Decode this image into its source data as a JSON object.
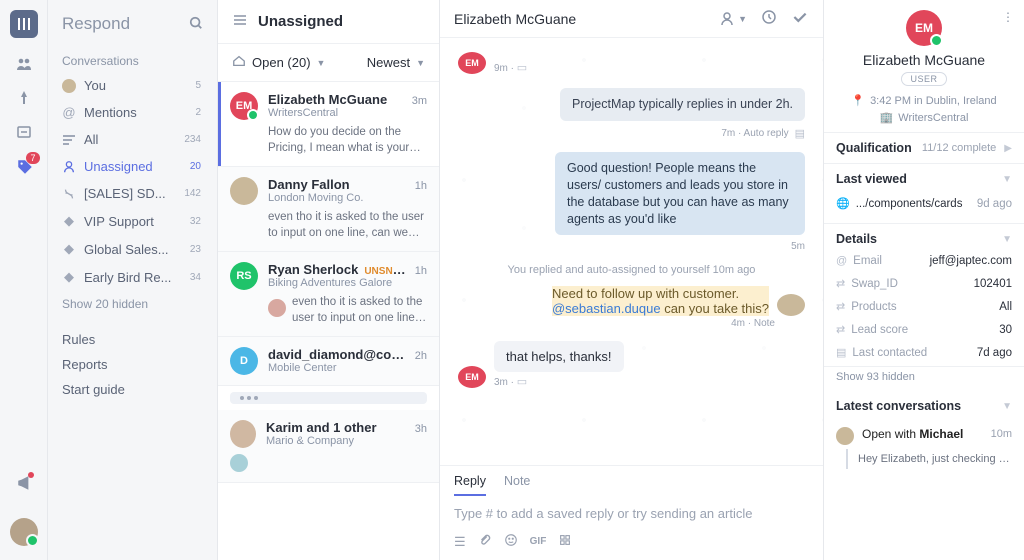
{
  "rail": {
    "tags_badge": "7"
  },
  "nav": {
    "title": "Respond",
    "section": "Conversations",
    "items": [
      {
        "label": "You",
        "count": "5"
      },
      {
        "label": "Mentions",
        "count": "2"
      },
      {
        "label": "All",
        "count": "234"
      },
      {
        "label": "Unassigned",
        "count": "20"
      },
      {
        "label": "[SALES] SD...",
        "count": "142"
      },
      {
        "label": "VIP Support",
        "count": "32"
      },
      {
        "label": "Global Sales...",
        "count": "23"
      },
      {
        "label": "Early Bird Re...",
        "count": "34"
      }
    ],
    "show_hidden": "Show 20 hidden",
    "foot": [
      "Rules",
      "Reports",
      "Start guide"
    ]
  },
  "list": {
    "title": "Unassigned",
    "filter_status": "Open (20)",
    "sort": "Newest",
    "items": [
      {
        "name": "Elizabeth McGuane",
        "org": "WritersCentral",
        "time": "3m",
        "preview": "How do you decide on the Pricing, I mean what is your definition of People? When...",
        "initials": "EM",
        "color": "#e1465a"
      },
      {
        "name": "Danny Fallon",
        "org": "London Moving Co.",
        "time": "1h",
        "preview": "even tho it is asked to the user to input on one line, can we show more lines of text...",
        "color": "#c9b89a"
      },
      {
        "name": "Ryan Sherlock",
        "org": "Biking Adventures Galore",
        "time": "1h",
        "tag": "UNSNOOZED",
        "preview": "even tho it is asked to the user to input on one line, can we show...",
        "initials": "RS",
        "color": "#1fc36a"
      },
      {
        "name": "david_diamond@comp...",
        "org": "Mobile Center",
        "time": "2h",
        "preview": "",
        "initials": "D",
        "color": "#4bb7e6"
      },
      {
        "name": "Karim and 1 other",
        "org": "Mario & Company",
        "time": "3h",
        "preview": "",
        "color": "#d0b8a2"
      }
    ]
  },
  "thread": {
    "name": "Elizabeth McGuane",
    "time_marker": "9m",
    "auto_reply": {
      "text": "ProjectMap typically replies in under 2h.",
      "meta": "7m · Auto reply"
    },
    "agent_reply": {
      "text": "Good question! People means the users/ customers and leads you store in the database but you can have as many agents as you'd like",
      "meta": "5m"
    },
    "center": "You replied and auto-assigned to yourself 10m ago",
    "note": {
      "line1": "Need to follow up with customer.",
      "mention": "@sebastian.duque",
      "rest": " can you take this?",
      "meta": "4m · Note"
    },
    "customer_reply": {
      "text": "that helps, thanks!",
      "meta": "3m · "
    },
    "composer": {
      "tab_reply": "Reply",
      "tab_note": "Note",
      "placeholder": "Type # to add a saved reply or try sending an article"
    }
  },
  "side": {
    "name": "Elizabeth McGuane",
    "role": "USER",
    "time_place": "3:42 PM in Dublin, Ireland",
    "company": "WritersCentral",
    "qual_title": "Qualification",
    "qual_progress": "11/12 complete",
    "lv_title": "Last viewed",
    "lv_path": ".../components/cards",
    "lv_time": "9d ago",
    "details_title": "Details",
    "details": [
      {
        "k": "Email",
        "v": "jeff@japtec.com"
      },
      {
        "k": "Swap_ID",
        "v": "102401"
      },
      {
        "k": "Products",
        "v": "All"
      },
      {
        "k": "Lead score",
        "v": "30"
      },
      {
        "k": "Last contacted",
        "v": "7d ago"
      }
    ],
    "details_hidden": "Show 93 hidden",
    "lc_title": "Latest conversations",
    "lc_label_open": "Open with ",
    "lc_with": "Michael",
    "lc_time": "10m",
    "lc_preview": "Hey Elizabeth, just checking in on..."
  }
}
